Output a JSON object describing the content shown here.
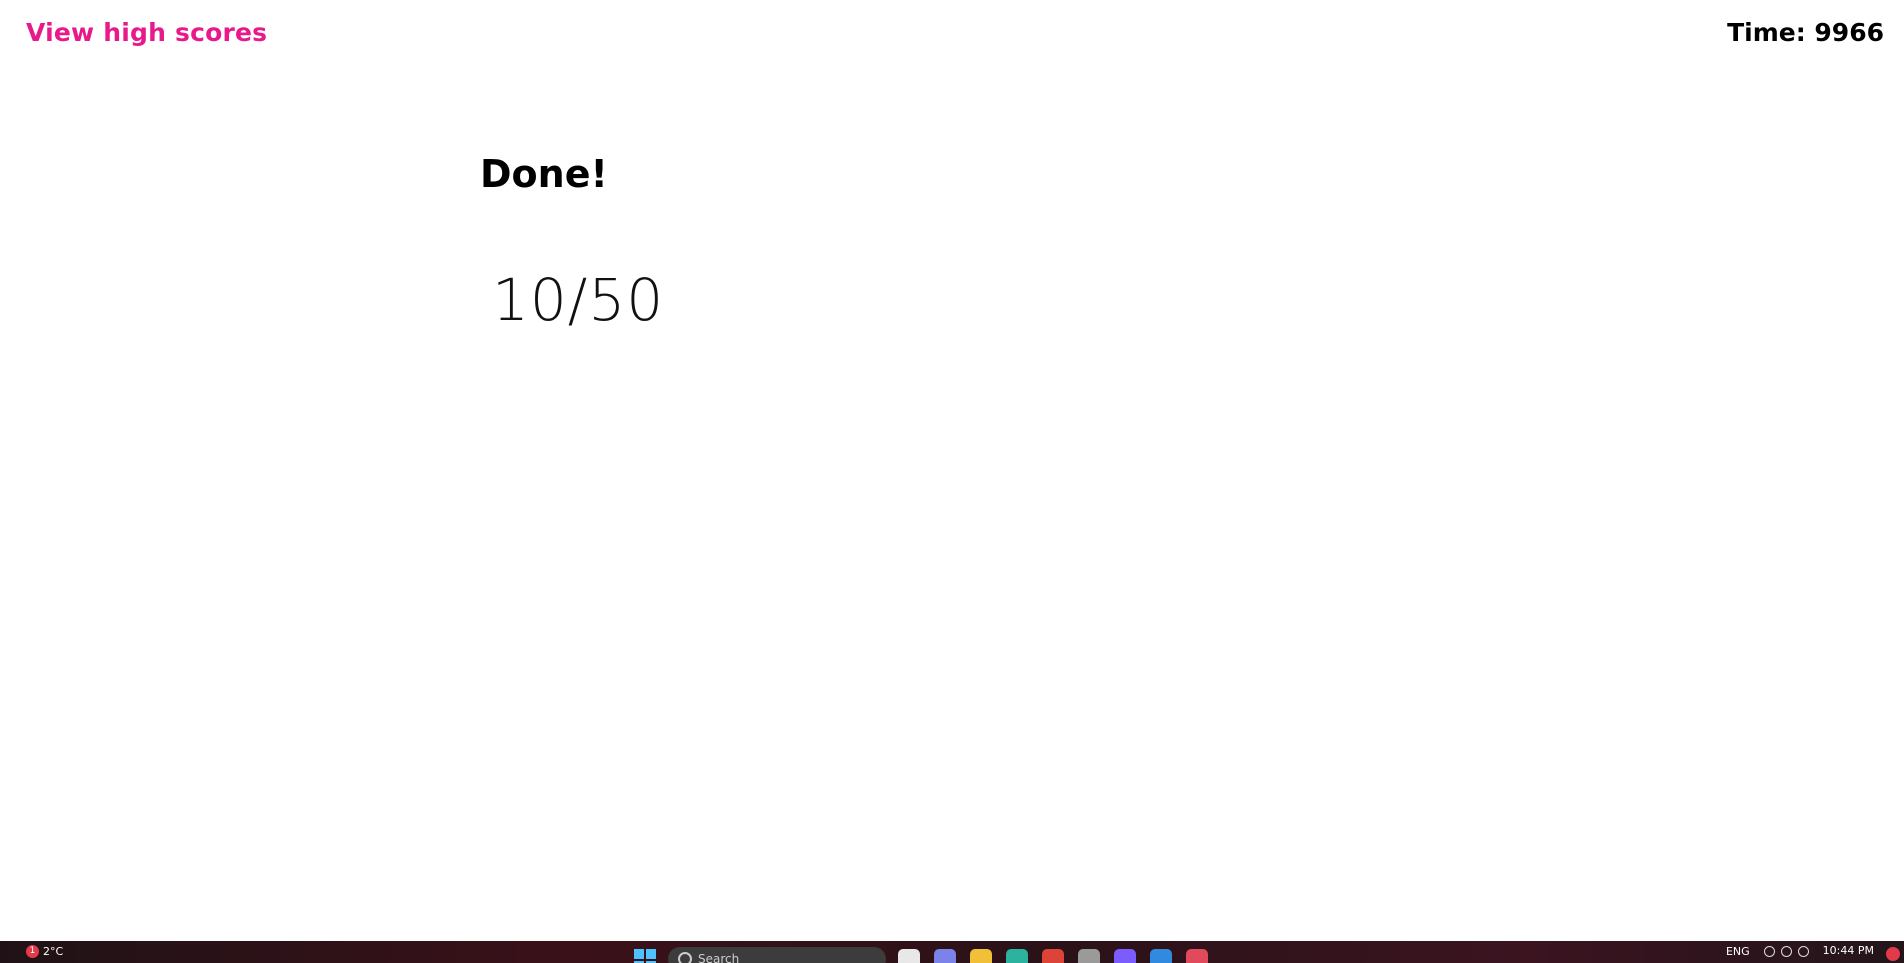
{
  "header": {
    "high_scores_link": "View high scores",
    "timer_text": "Time: 9966"
  },
  "main": {
    "title": "Done!",
    "score": "10/50"
  },
  "taskbar": {
    "weather_badge": "1",
    "weather_temp": "2°C",
    "search_placeholder": "Search",
    "language": "ENG",
    "clock": "10:44 PM",
    "apps": [
      {
        "name": "file-icon",
        "color": "#e8e8e8"
      },
      {
        "name": "chat-icon",
        "color": "#7b83eb"
      },
      {
        "name": "folder-icon",
        "color": "#f2c037"
      },
      {
        "name": "edge-icon",
        "color": "#2bb3a0"
      },
      {
        "name": "chrome-icon",
        "color": "#db4437"
      },
      {
        "name": "settings-icon",
        "color": "#9a9a9a"
      },
      {
        "name": "messenger-icon",
        "color": "#7b5cff"
      },
      {
        "name": "vscode-icon",
        "color": "#2f8ae0"
      },
      {
        "name": "calendar-icon",
        "color": "#e04a5a"
      }
    ],
    "colors": {
      "accent_link": "#e8198b",
      "start": "#4cc2ff"
    }
  }
}
